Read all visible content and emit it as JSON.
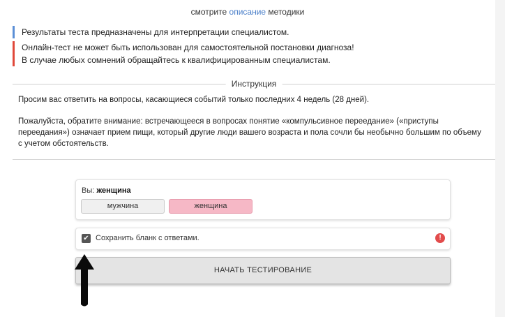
{
  "header": {
    "prefix": "смотрите",
    "link": "описание",
    "suffix": "методики"
  },
  "notices": {
    "info": "Результаты теста предназначены для интерпретации специалистом.",
    "warning_line1": "Онлайн-тест не может быть использован для самостоятельной постановки диагноза!",
    "warning_line2": "В случае любых сомнений обращайтесь к квалифицированным специалистам."
  },
  "instructions": {
    "title": "Инструкция",
    "paragraph1": "Просим вас ответить на вопросы, касающиеся событий только последних 4 недель (28 дней).",
    "paragraph2": "Пожалуйста, обратите внимание: встречающееся в вопросах понятие «компульсивное переедание» («приступы переедания») означает прием пищи, который другие люди вашего возраста и пола сочли бы необычно большим по объему с учетом обстоятельств."
  },
  "gender": {
    "caption_prefix": "Вы:",
    "selected": "женщина",
    "options": [
      "мужчина",
      "женщина"
    ]
  },
  "save_form": {
    "label": "Сохранить бланк с ответами.",
    "checked": true,
    "alert_icon": "!"
  },
  "start_button": {
    "label": "НАЧАТЬ ТЕСТИРОВАНИЕ"
  },
  "colors": {
    "link": "#4a7fc9",
    "info_bar": "#5b8fd6",
    "warning_bar": "#e0483a",
    "female_selected": "#f6b8c6",
    "alert": "#e24b4b"
  }
}
